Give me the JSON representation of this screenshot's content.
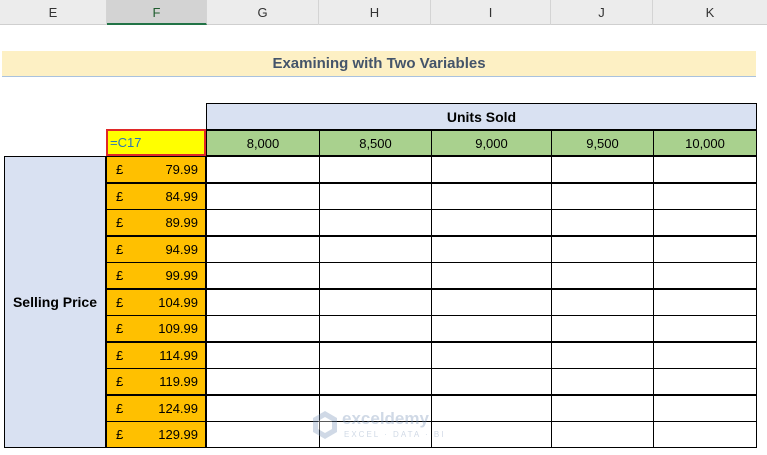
{
  "columns": [
    "E",
    "F",
    "G",
    "H",
    "I",
    "J",
    "K"
  ],
  "active_column": "F",
  "title": "Examining with Two Variables",
  "units_header": "Units Sold",
  "formula_cell": "=C17",
  "units": [
    "8,000",
    "8,500",
    "9,000",
    "9,500",
    "10,000"
  ],
  "price_label": "Selling Price",
  "currency": "£",
  "prices": [
    "79.99",
    "84.99",
    "89.99",
    "94.99",
    "99.99",
    "104.99",
    "109.99",
    "114.99",
    "119.99",
    "124.99",
    "129.99"
  ],
  "colors": {
    "price_fill": "#ffc000",
    "units_fill": "#a9d18e",
    "header_fill": "#d9e1f2",
    "formula_fill": "#ffff00",
    "formula_border": "#e02828",
    "title_fill": "#fdf0c4"
  },
  "watermark": {
    "icon": "exceldemy-logo-icon",
    "name": "exceldemy",
    "sub": "EXCEL · DATA · BI"
  }
}
